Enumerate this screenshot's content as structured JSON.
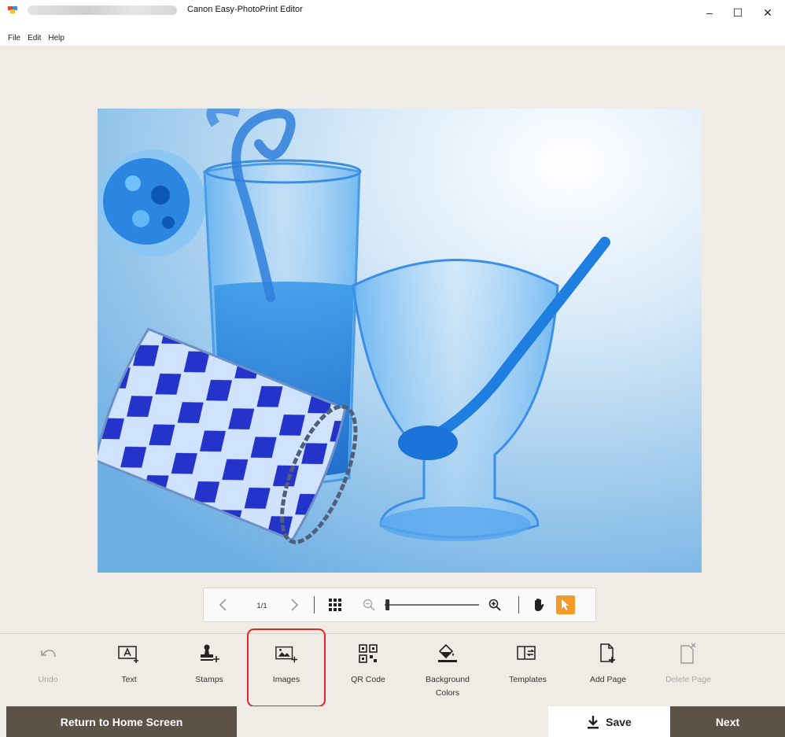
{
  "window": {
    "title": "Canon Easy-PhotoPrint Editor",
    "minimize": "‒",
    "maximize": "☐",
    "close": "✕"
  },
  "menu": [
    "File",
    "Edit",
    "Help"
  ],
  "navigator": {
    "page_indicator": "1/1",
    "zoom_level": 0.03
  },
  "toolbar": {
    "undo": "Undo",
    "text": "Text",
    "stamps": "Stamps",
    "images": "Images",
    "qr_code": "QR Code",
    "background_colors_line1": "Background",
    "background_colors_line2": "Colors",
    "templates": "Templates",
    "add_page": "Add Page",
    "delete_page": "Delete Page"
  },
  "footer": {
    "return_home": "Return to Home Screen",
    "save": "Save",
    "next": "Next"
  },
  "colors": {
    "accent_orange": "#f39a2a",
    "footer_brown": "#5d5247",
    "workspace_beige": "#f0ece5",
    "highlight_red": "#e0262c"
  }
}
